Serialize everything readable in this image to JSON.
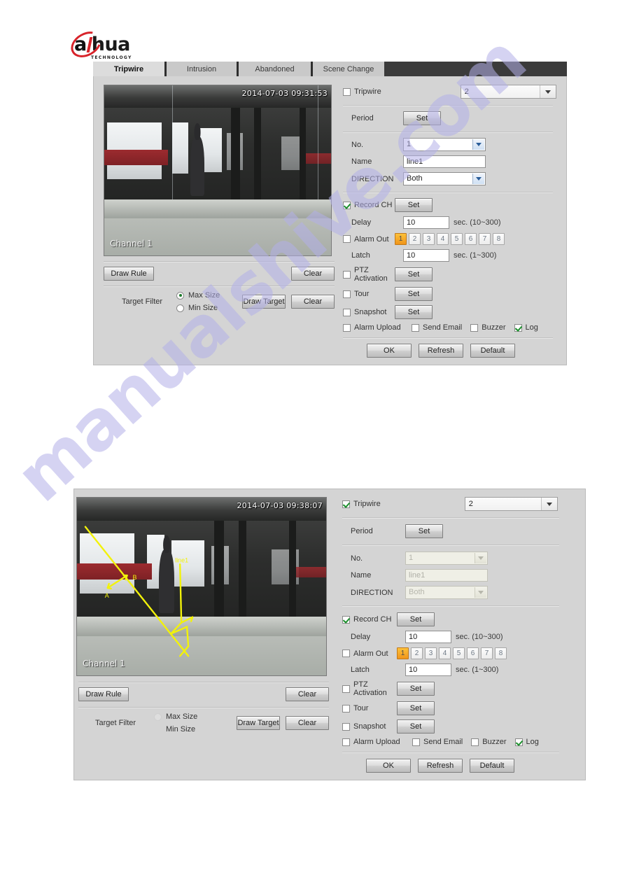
{
  "brand": {
    "name": "alhua",
    "name_part_a": "a",
    "name_part_b": "hua",
    "tagline": "TECHNOLOGY"
  },
  "watermark": {
    "text": "manualshive.com"
  },
  "tabs": [
    {
      "label": "Tripwire",
      "active": true
    },
    {
      "label": "Intrusion",
      "active": false
    },
    {
      "label": "Abandoned",
      "active": false
    },
    {
      "label": "Scene Change",
      "active": false
    }
  ],
  "panel_top": {
    "video": {
      "timestamp": "2014-07-03 09:31:53",
      "channel": "Channel 1"
    },
    "draw_rule_button": "Draw Rule",
    "rule_clear_button": "Clear",
    "target_filter_label": "Target Filter",
    "max_size_label": "Max Size",
    "min_size_label": "Min Size",
    "target_filter_selected": "Max Size",
    "draw_target_button": "Draw Target",
    "target_clear_button": "Clear",
    "enable": {
      "label": "Tripwire",
      "checked": false
    },
    "channel_select": {
      "value": "2"
    },
    "period": {
      "label": "Period",
      "button": "Set"
    },
    "no": {
      "label": "No.",
      "value": "1",
      "disabled": false
    },
    "name": {
      "label": "Name",
      "value": "line1",
      "disabled": false
    },
    "direction": {
      "label": "DIRECTION",
      "value": "Both",
      "disabled": false
    },
    "record_ch": {
      "label": "Record CH",
      "checked": true,
      "button": "Set"
    },
    "delay": {
      "label": "Delay",
      "value": "10",
      "unit": "sec. (10~300)"
    },
    "alarm_out": {
      "label": "Alarm Out",
      "checked": false,
      "buttons": [
        "1",
        "2",
        "3",
        "4",
        "5",
        "6",
        "7",
        "8"
      ],
      "active": [
        "1"
      ]
    },
    "latch": {
      "label": "Latch",
      "value": "10",
      "unit": "sec. (1~300)"
    },
    "ptz_activation": {
      "label": "PTZ Activation",
      "checked": false,
      "button": "Set"
    },
    "tour": {
      "label": "Tour",
      "checked": false,
      "button": "Set"
    },
    "snapshot": {
      "label": "Snapshot",
      "checked": false,
      "button": "Set"
    },
    "alarm_upload": {
      "label": "Alarm Upload",
      "checked": false
    },
    "send_email": {
      "label": "Send Email",
      "checked": false
    },
    "buzzer": {
      "label": "Buzzer",
      "checked": false
    },
    "log": {
      "label": "Log",
      "checked": true
    },
    "actions": {
      "ok": "OK",
      "refresh": "Refresh",
      "default": "Default"
    }
  },
  "panel_bottom": {
    "video": {
      "timestamp": "2014-07-03 09:38:07",
      "channel": "Channel 1",
      "rule_name": "line1",
      "point_a_label": "A",
      "point_b_label": "B"
    },
    "draw_rule_button": "Draw Rule",
    "rule_clear_button": "Clear",
    "target_filter_label": "Target Filter",
    "max_size_label": "Max Size",
    "min_size_label": "Min Size",
    "target_filter_selected": "",
    "draw_target_button": "Draw Target",
    "target_clear_button": "Clear",
    "enable": {
      "label": "Tripwire",
      "checked": true
    },
    "channel_select": {
      "value": "2"
    },
    "period": {
      "label": "Period",
      "button": "Set"
    },
    "no": {
      "label": "No.",
      "value": "1",
      "disabled": true
    },
    "name": {
      "label": "Name",
      "value": "line1",
      "disabled": true
    },
    "direction": {
      "label": "DIRECTION",
      "value": "Both",
      "disabled": true
    },
    "record_ch": {
      "label": "Record CH",
      "checked": true,
      "button": "Set"
    },
    "delay": {
      "label": "Delay",
      "value": "10",
      "unit": "sec. (10~300)"
    },
    "alarm_out": {
      "label": "Alarm Out",
      "checked": false,
      "buttons": [
        "1",
        "2",
        "3",
        "4",
        "5",
        "6",
        "7",
        "8"
      ],
      "active": [
        "1"
      ]
    },
    "latch": {
      "label": "Latch",
      "value": "10",
      "unit": "sec. (1~300)"
    },
    "ptz_activation": {
      "label": "PTZ Activation",
      "checked": false,
      "button": "Set"
    },
    "tour": {
      "label": "Tour",
      "checked": false,
      "button": "Set"
    },
    "snapshot": {
      "label": "Snapshot",
      "checked": false,
      "button": "Set"
    },
    "alarm_upload": {
      "label": "Alarm Upload",
      "checked": false
    },
    "send_email": {
      "label": "Send Email",
      "checked": false
    },
    "buzzer": {
      "label": "Buzzer",
      "checked": false
    },
    "log": {
      "label": "Log",
      "checked": true
    },
    "actions": {
      "ok": "OK",
      "refresh": "Refresh",
      "default": "Default"
    }
  },
  "colors": {
    "alarm_active": "#f0941a",
    "check_green": "#1a8f2b",
    "brand_red": "#d8232a",
    "rule_yellow": "#f2f20a",
    "watermark": "#b3b0e8"
  }
}
